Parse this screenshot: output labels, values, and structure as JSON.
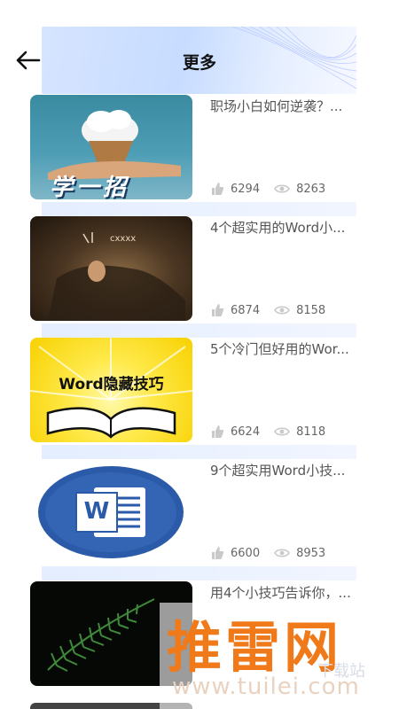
{
  "header": {
    "title": "更多",
    "back_icon": "arrow-left-icon"
  },
  "icons": {
    "like": "thumb-up-icon",
    "views": "eye-icon"
  },
  "colors": {
    "accent": "#f07a1a",
    "text": "#555555",
    "header_bg": "#c7dcff"
  },
  "articles": [
    {
      "title": "职场小白如何逆袭？...",
      "likes": "6294",
      "views": "8263",
      "thumb_text": "学一招"
    },
    {
      "title": "4个超实用的Word小...",
      "likes": "6874",
      "views": "8158",
      "thumb_text": ""
    },
    {
      "title": "5个冷门但好用的Wor...",
      "likes": "6624",
      "views": "8118",
      "thumb_text": "Word隐藏技巧"
    },
    {
      "title": "9个超实用Word小技...",
      "likes": "6600",
      "views": "8953",
      "thumb_text": "W"
    },
    {
      "title": "用4个小技巧告诉你，...",
      "likes": "",
      "views": "",
      "thumb_text": ""
    }
  ],
  "watermark": {
    "text": "推雷网",
    "url": "www.tuilei.com",
    "sub": "下载站"
  }
}
